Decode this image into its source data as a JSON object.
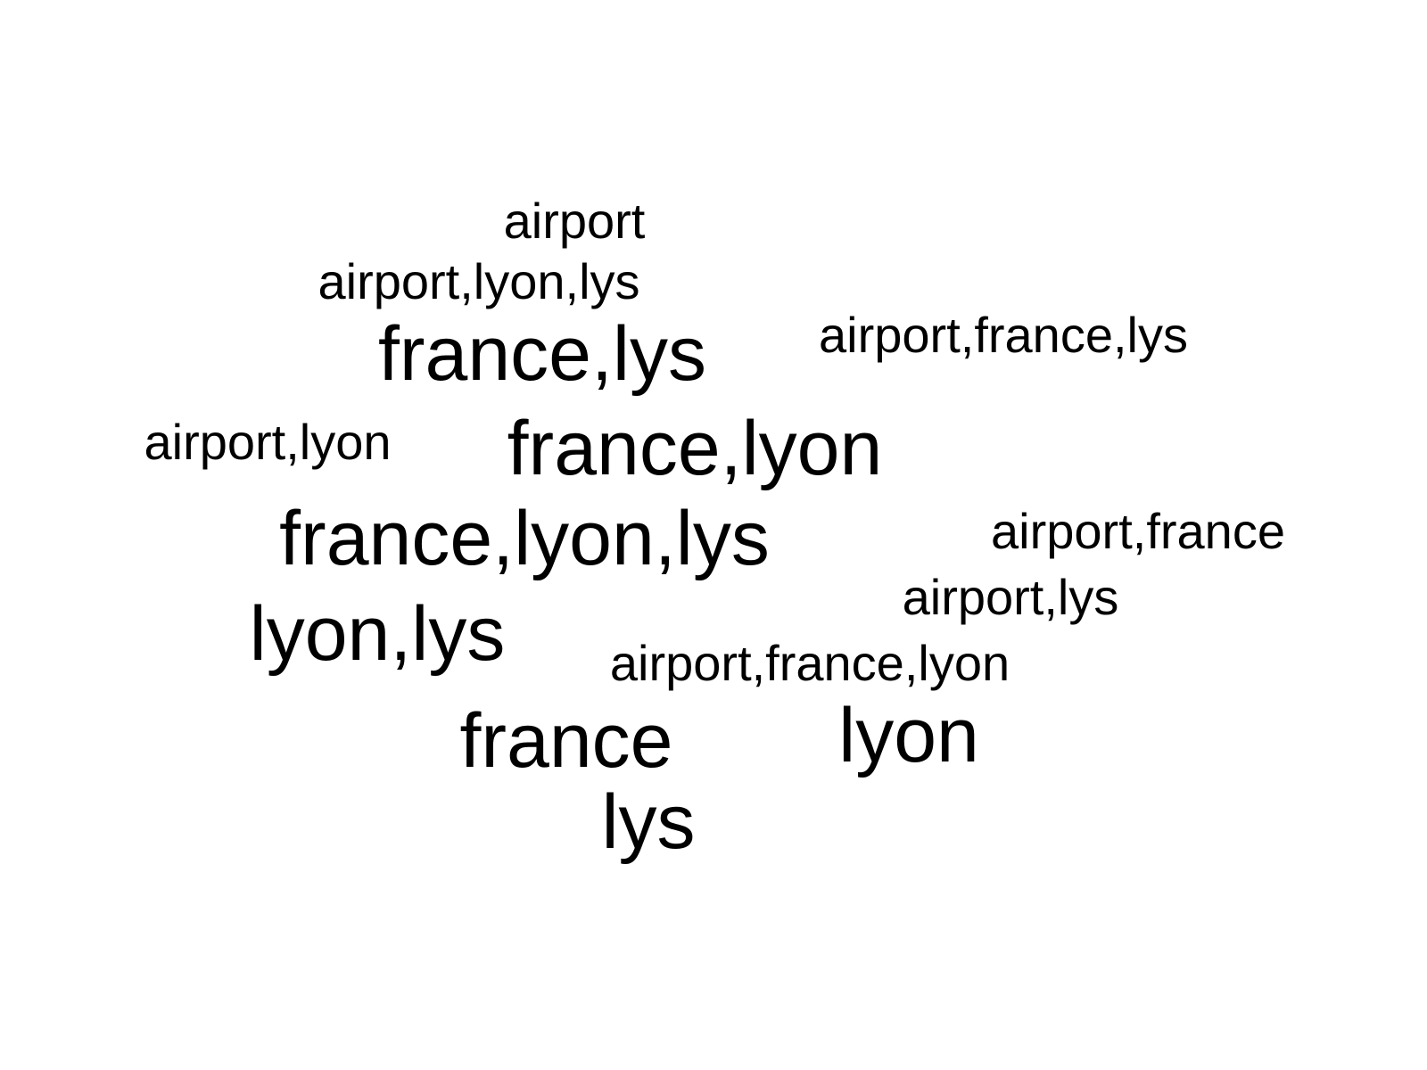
{
  "word_cloud": {
    "text_color": "#000000",
    "background_color": "#ffffff",
    "words": [
      {
        "text": "airport",
        "emphasis": "small"
      },
      {
        "text": "airport,lyon,lys",
        "emphasis": "small"
      },
      {
        "text": "france,lys",
        "emphasis": "large"
      },
      {
        "text": "airport,france,lys",
        "emphasis": "small"
      },
      {
        "text": "airport,lyon",
        "emphasis": "small"
      },
      {
        "text": "france,lyon",
        "emphasis": "large"
      },
      {
        "text": "france,lyon,lys",
        "emphasis": "large"
      },
      {
        "text": "airport,france",
        "emphasis": "small"
      },
      {
        "text": "airport,lys",
        "emphasis": "small"
      },
      {
        "text": "lyon,lys",
        "emphasis": "large"
      },
      {
        "text": "airport,france,lyon",
        "emphasis": "small"
      },
      {
        "text": "france",
        "emphasis": "large"
      },
      {
        "text": "lyon",
        "emphasis": "large"
      },
      {
        "text": "lys",
        "emphasis": "large"
      }
    ]
  }
}
